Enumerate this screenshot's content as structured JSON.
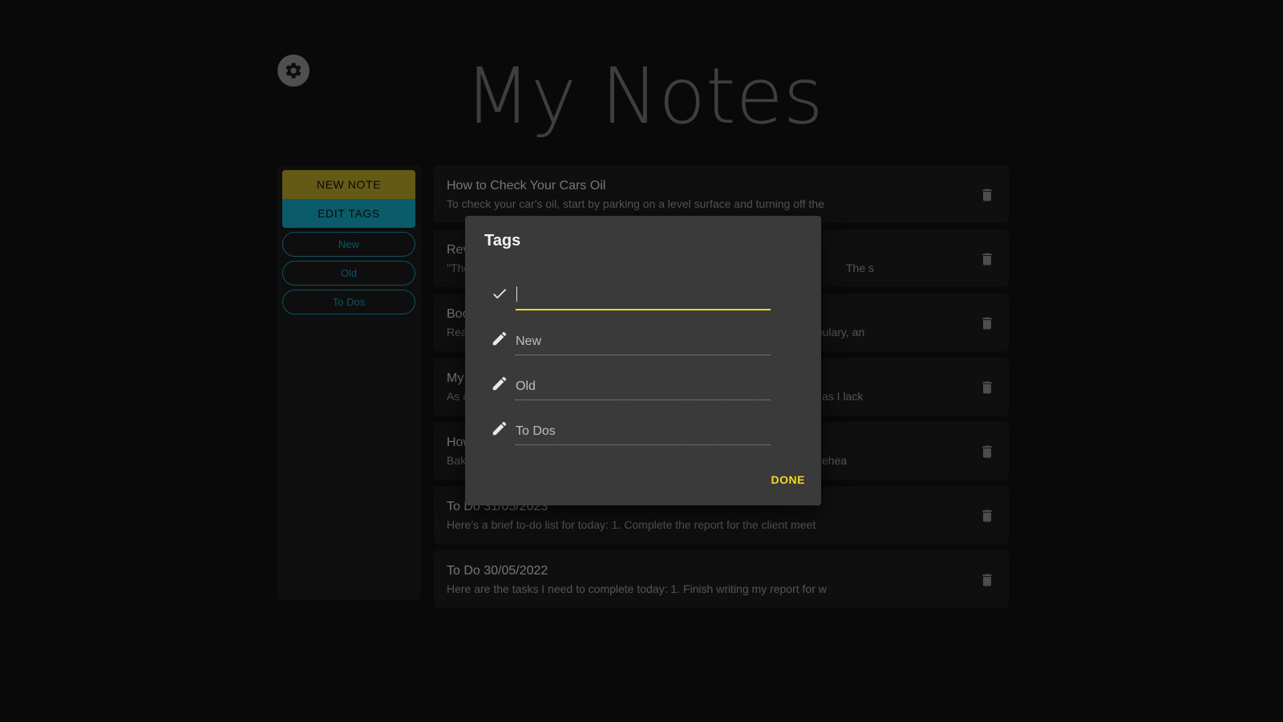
{
  "app": {
    "title": "My Notes",
    "accent_primary": "#c8b52a",
    "accent_secondary": "#17b9d6",
    "dialog_accent": "#f5d623"
  },
  "sidebar": {
    "new_note_label": "NEW NOTE",
    "edit_tags_label": "EDIT TAGS",
    "tags": [
      "New",
      "Old",
      "To Dos"
    ]
  },
  "notes": [
    {
      "title": "How to Check Your Cars Oil",
      "preview": "To check your car's oil, start by parking on a level surface and turning off the"
    },
    {
      "title": "Rev",
      "preview": "\"The",
      "preview_tail": "The s"
    },
    {
      "title": "Boo",
      "preview": "Rea",
      "preview_tail": "abulary, an"
    },
    {
      "title": "My",
      "preview": "As a",
      "preview_tail": "as I lack"
    },
    {
      "title": "How",
      "preview": "Bak",
      "preview_tail": "Prehea"
    },
    {
      "title": "To Do 31/05/2023",
      "preview": "Here's a brief to-do list for today: 1. Complete the report for the client meet"
    },
    {
      "title": "To Do 30/05/2022",
      "preview": "Here are the tasks I need to complete today: 1. Finish writing my report for w"
    }
  ],
  "dialog": {
    "title": "Tags",
    "new_tag_value": "",
    "tags": [
      "New",
      "Old",
      "To Dos"
    ],
    "done_label": "DONE"
  },
  "icons": {
    "settings": "gear-icon",
    "delete": "trash-icon",
    "confirm": "check-icon",
    "edit": "pencil-icon"
  }
}
